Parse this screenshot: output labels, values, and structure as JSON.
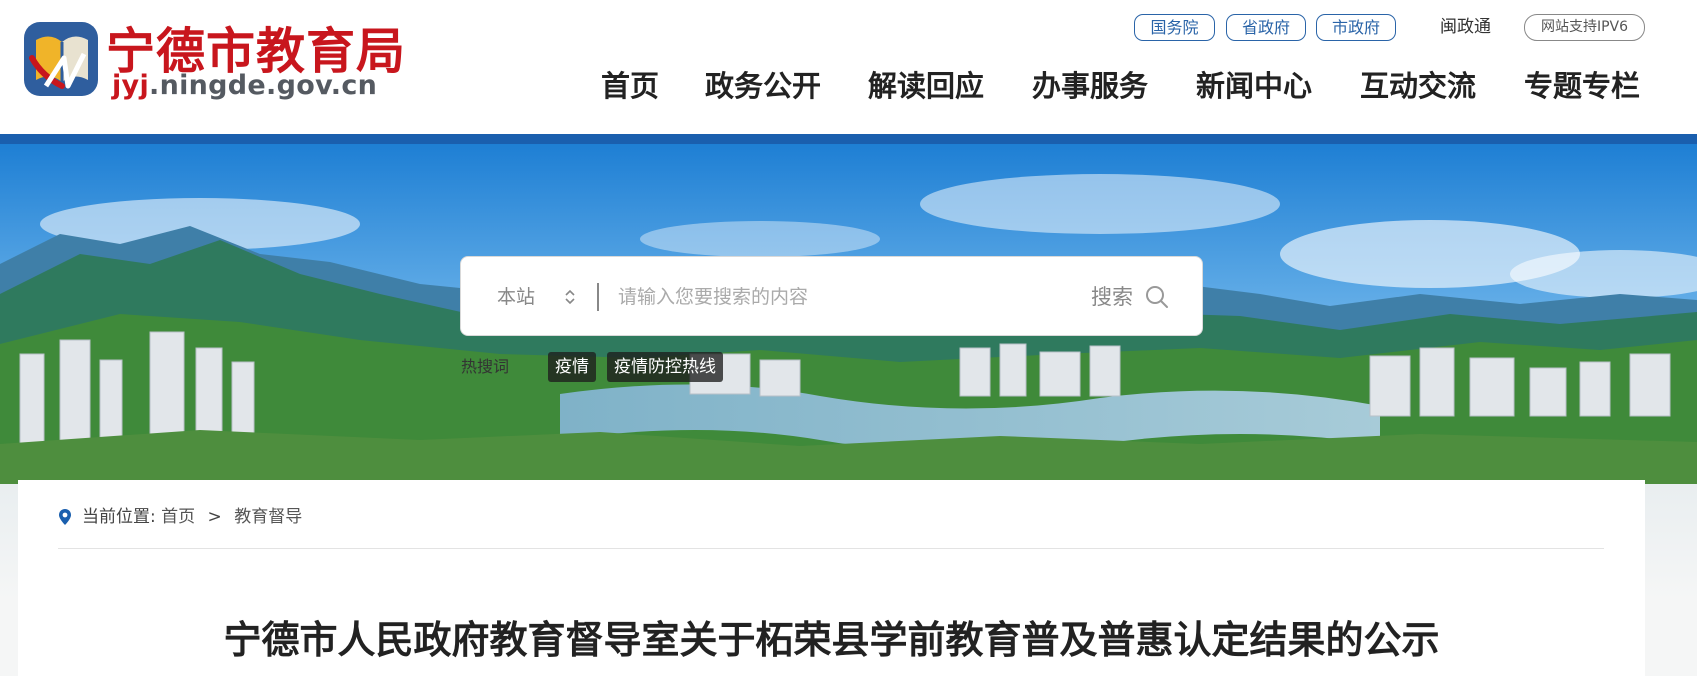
{
  "site": {
    "title_cn": "宁德市教育局",
    "domain_prefix": "jyj",
    "domain_suffix": ".ningde.gov.cn"
  },
  "top_links": {
    "guowuyuan": "国务院",
    "shengzhengfu": "省政府",
    "shizhengfu": "市政府",
    "minzhengtong": "闽政通",
    "ipv6": "网站支持IPV6"
  },
  "nav": [
    {
      "label": "首页"
    },
    {
      "label": "政务公开"
    },
    {
      "label": "解读回应"
    },
    {
      "label": "办事服务"
    },
    {
      "label": "新闻中心"
    },
    {
      "label": "互动交流"
    },
    {
      "label": "专题专栏"
    }
  ],
  "search": {
    "scope": "本站",
    "placeholder": "请输入您要搜索的内容",
    "button_label": "搜索"
  },
  "hotwords": {
    "label": "热搜词",
    "tags": [
      "疫情",
      "疫情防控热线"
    ]
  },
  "breadcrumb": {
    "prefix": "当前位置:",
    "home": "首页",
    "separator": ">",
    "current": "教育督导"
  },
  "article": {
    "title": "宁德市人民政府教育督导室关于柘荣县学前教育普及普惠认定结果的公示"
  },
  "colors": {
    "brand_red": "#c8161d",
    "brand_blue": "#1a5fae"
  }
}
